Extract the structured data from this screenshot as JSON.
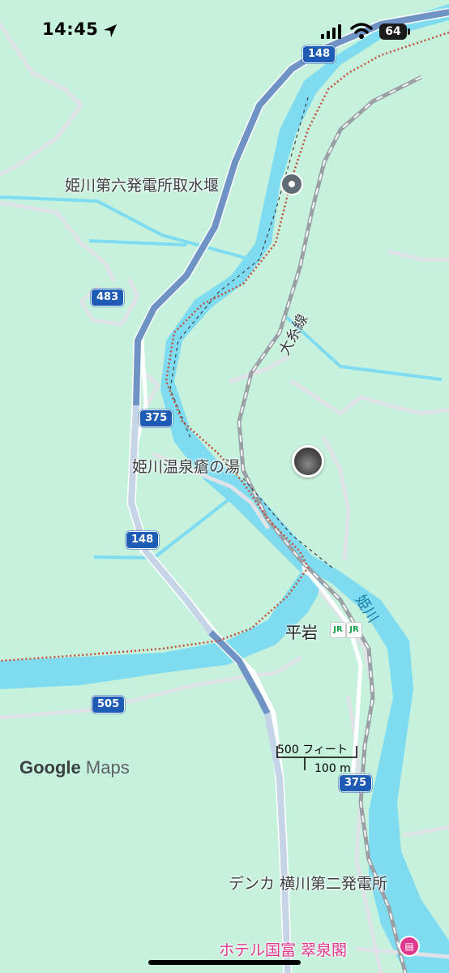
{
  "status_bar": {
    "time": "14:45",
    "battery": "64",
    "icons": [
      "location-arrow-icon",
      "signal-icon",
      "wifi-icon",
      "battery-icon"
    ]
  },
  "map": {
    "colors": {
      "land": "#c6f1dc",
      "water": "#7fdcf0",
      "highway": "#6f93c4",
      "road": "#ffffff",
      "rail": "#9aa0a6",
      "border": "#c0503c"
    },
    "routes": {
      "r148_top": "148",
      "r483": "483",
      "r375_mid": "375",
      "r148_mid": "148",
      "r505": "505",
      "r375_bottom": "375"
    },
    "places": {
      "dam": "姫川第六発電所取水堰",
      "onsen": "姫川温泉瘡の湯",
      "power_station": "デンカ 横川第二発電所",
      "hotel": "ホテル国富 翠泉閣"
    },
    "station": {
      "name": "平岩",
      "operator_icons": [
        "JR",
        "JR"
      ]
    },
    "rail_line": "大糸線",
    "river": "姫川",
    "scale": {
      "imperial": "500 フィート",
      "metric": "100 m"
    },
    "logo": {
      "brand": "Google",
      "product": "Maps"
    }
  }
}
